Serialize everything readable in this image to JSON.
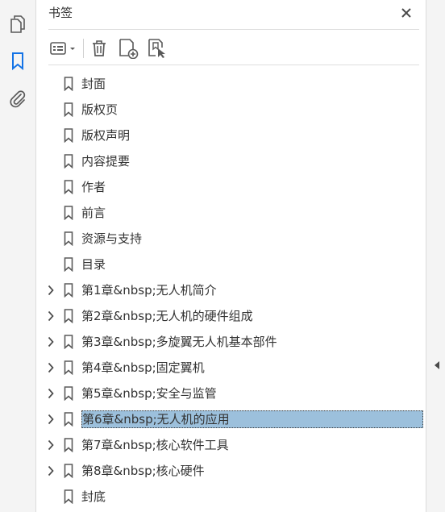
{
  "rail": {
    "items": [
      {
        "name": "pages",
        "icon": "pages-icon"
      },
      {
        "name": "bookmarks",
        "icon": "bookmark-icon",
        "active": true
      },
      {
        "name": "attachments",
        "icon": "paperclip-icon"
      }
    ]
  },
  "panel": {
    "title": "书签"
  },
  "toolbar": {
    "buttons": [
      "options-menu-icon",
      "trash-icon",
      "new-bookmark-icon",
      "bookmark-properties-icon"
    ]
  },
  "bookmarks": [
    {
      "label": "封面",
      "expandable": false,
      "selected": false
    },
    {
      "label": "版权页",
      "expandable": false,
      "selected": false
    },
    {
      "label": "版权声明",
      "expandable": false,
      "selected": false
    },
    {
      "label": "内容提要",
      "expandable": false,
      "selected": false
    },
    {
      "label": "作者",
      "expandable": false,
      "selected": false
    },
    {
      "label": "前言",
      "expandable": false,
      "selected": false
    },
    {
      "label": "资源与支持",
      "expandable": false,
      "selected": false
    },
    {
      "label": "目录",
      "expandable": false,
      "selected": false
    },
    {
      "label": "第1章&nbsp;无人机简介",
      "expandable": true,
      "selected": false
    },
    {
      "label": "第2章&nbsp;无人机的硬件组成",
      "expandable": true,
      "selected": false
    },
    {
      "label": "第3章&nbsp;多旋翼无人机基本部件",
      "expandable": true,
      "selected": false
    },
    {
      "label": "第4章&nbsp;固定翼机",
      "expandable": true,
      "selected": false
    },
    {
      "label": "第5章&nbsp;安全与监管",
      "expandable": true,
      "selected": false
    },
    {
      "label": "第6章&nbsp;无人机的应用",
      "expandable": true,
      "selected": true
    },
    {
      "label": "第7章&nbsp;核心软件工具",
      "expandable": true,
      "selected": false
    },
    {
      "label": "第8章&nbsp;核心硬件",
      "expandable": true,
      "selected": false
    },
    {
      "label": "封底",
      "expandable": false,
      "selected": false
    }
  ],
  "colors": {
    "accent": "#1473e6",
    "selection": "#9cc0dc",
    "icon": "#5a5a5a"
  }
}
